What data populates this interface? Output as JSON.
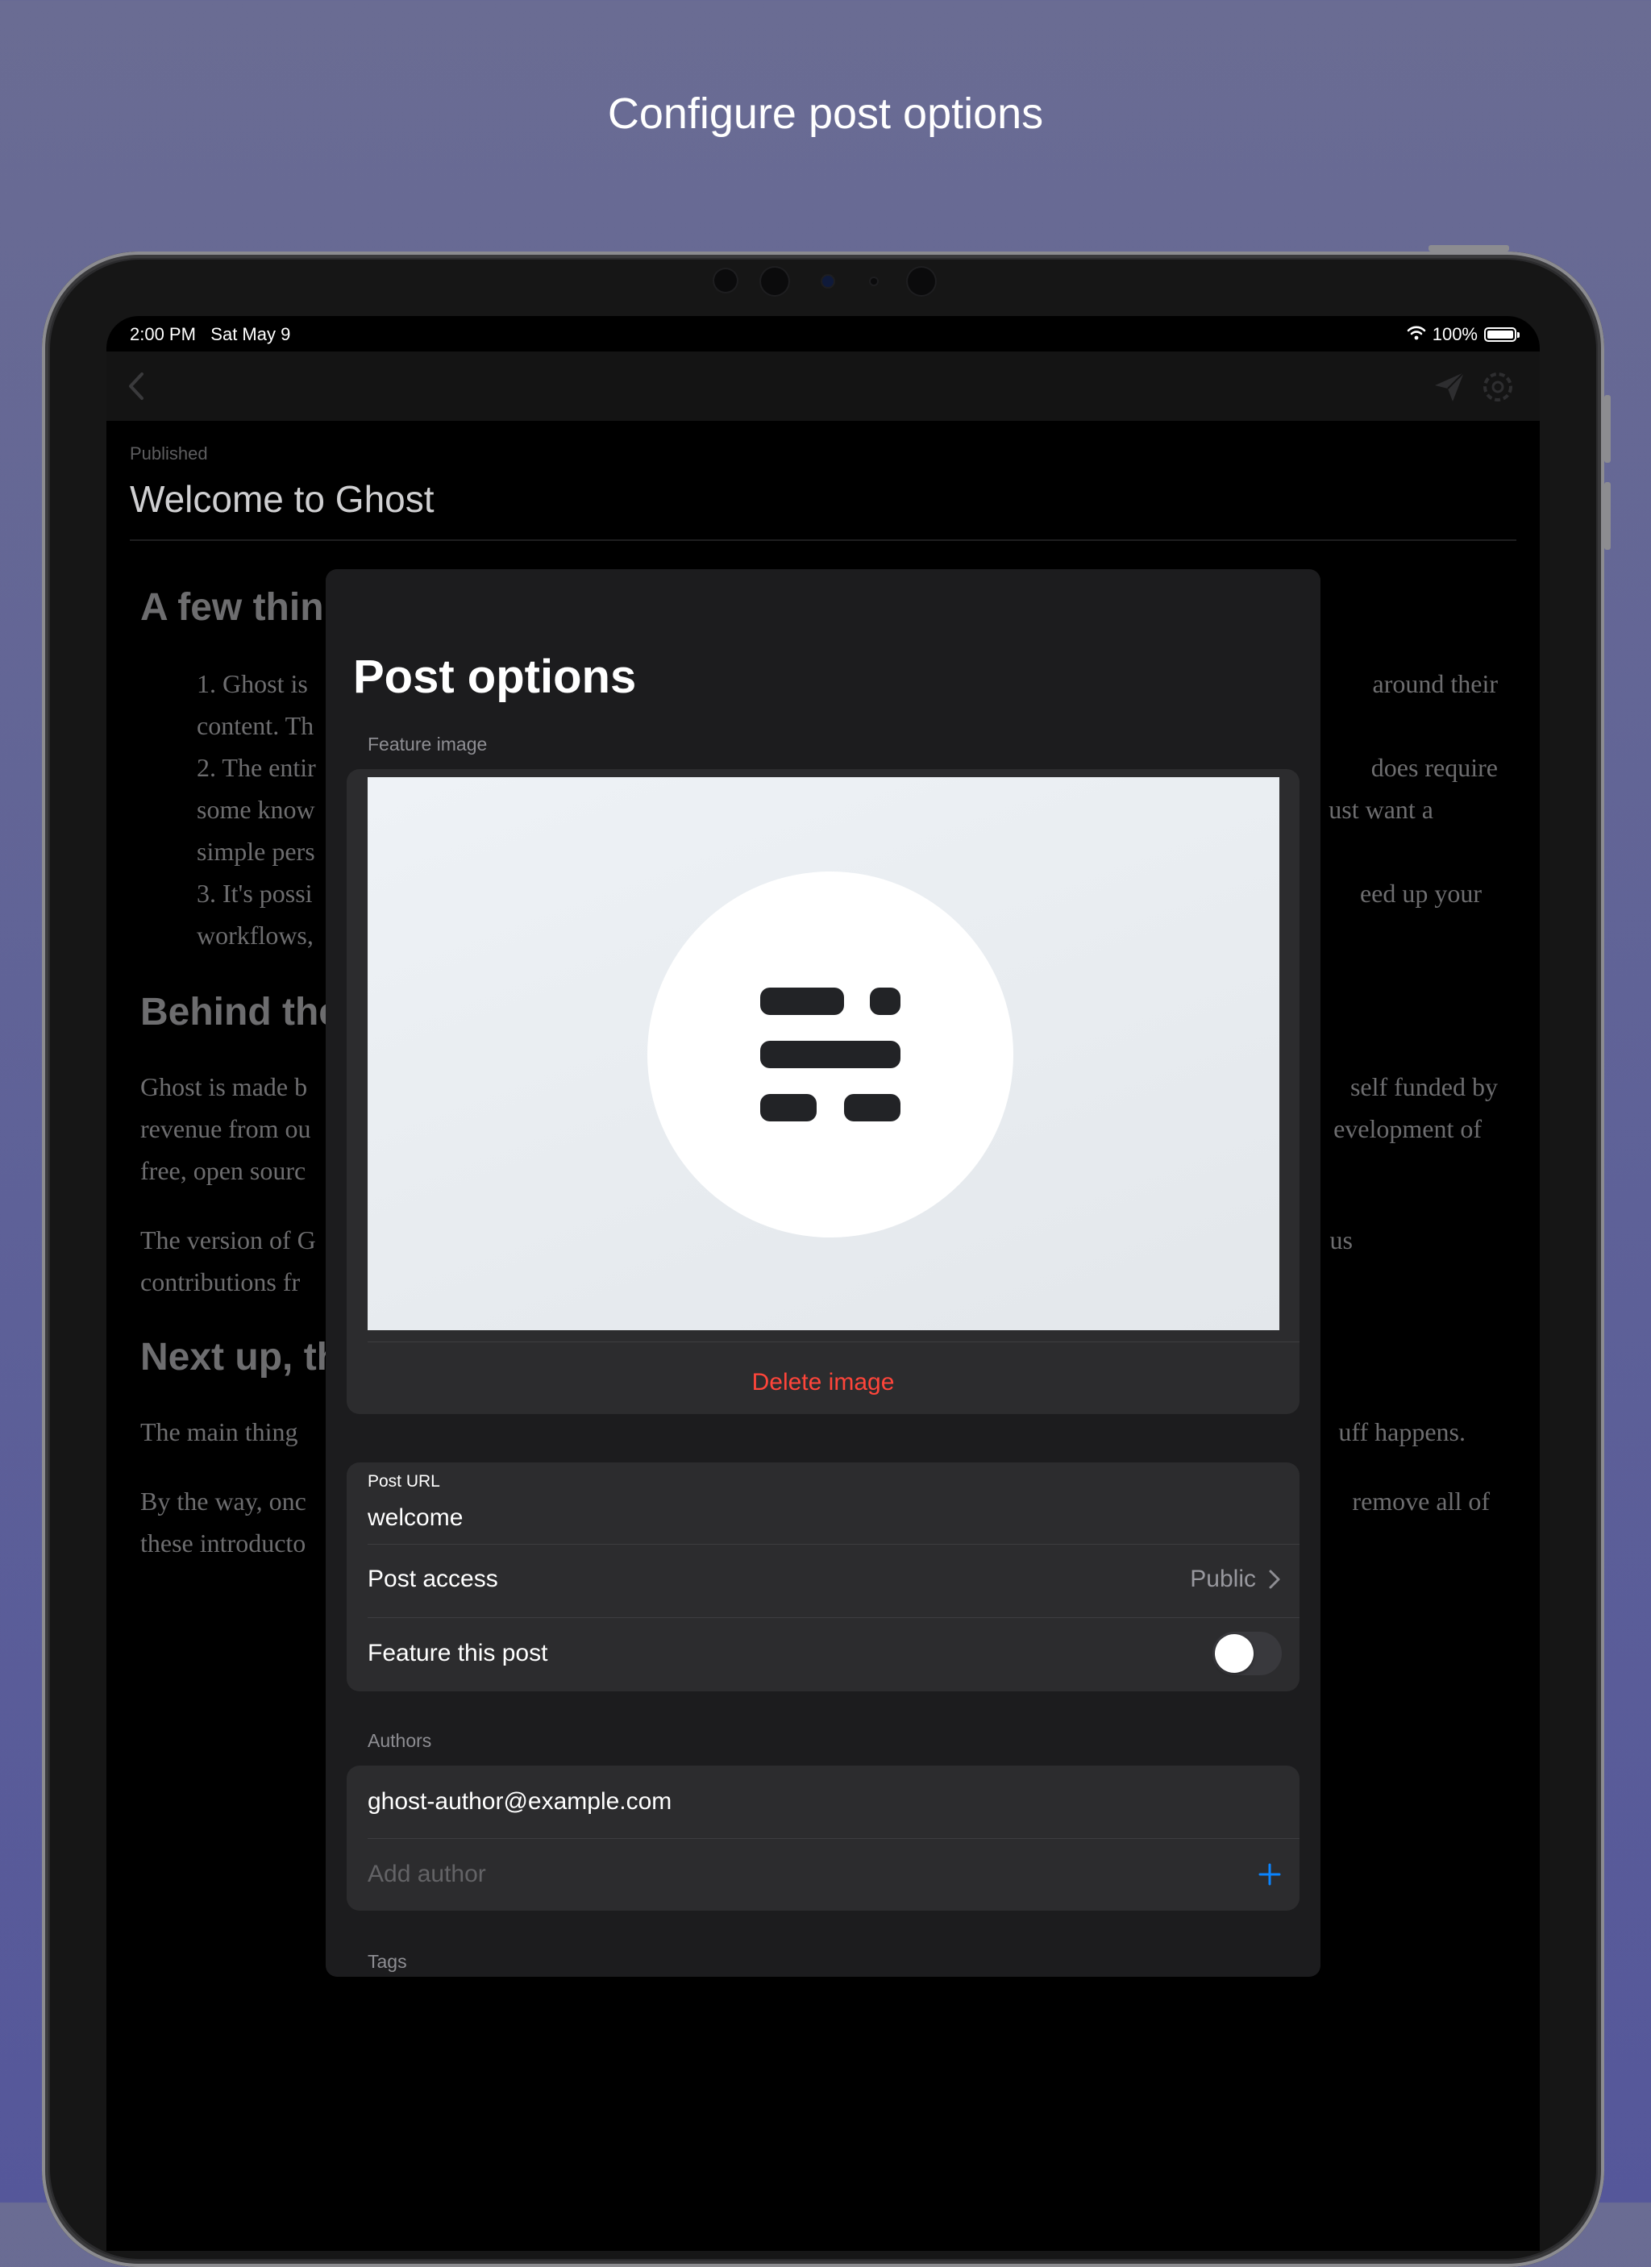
{
  "headline": "Configure post options",
  "status_bar": {
    "time": "2:00 PM",
    "date": "Sat May 9",
    "battery": "100%",
    "icons": [
      "wifi-icon",
      "battery-icon"
    ]
  },
  "nav": {
    "icons": [
      "chevron-left-icon",
      "send-icon",
      "gear-icon"
    ]
  },
  "editor": {
    "status": "Published",
    "title": "Welcome to Ghost",
    "visible_text": [
      {
        "kind": "heading",
        "left": "A few thin",
        "right": ""
      },
      {
        "kind": "text",
        "left": "1. Ghost is",
        "right": "around their"
      },
      {
        "kind": "text",
        "left": "content. Th",
        "right": ""
      },
      {
        "kind": "text",
        "left": "2. The entir",
        "right": "does require"
      },
      {
        "kind": "text",
        "left": "some know",
        "right": "ust want a"
      },
      {
        "kind": "text",
        "left": "simple pers",
        "right": ""
      },
      {
        "kind": "text",
        "left": "3. It's possi",
        "right": "eed up your"
      },
      {
        "kind": "text",
        "left": "workflows,",
        "right": ""
      },
      {
        "kind": "heading",
        "left": "Behind the",
        "right": ""
      },
      {
        "kind": "text",
        "left": "Ghost is made b",
        "right": "self funded by"
      },
      {
        "kind": "text",
        "left": "revenue from ou",
        "right": "evelopment of"
      },
      {
        "kind": "text",
        "left": "free, open sourc",
        "right": ""
      },
      {
        "kind": "text",
        "left": "The version of G",
        "right": "us"
      },
      {
        "kind": "text",
        "left": "contributions fr",
        "right": ""
      },
      {
        "kind": "heading",
        "left": "Next up, th",
        "right": ""
      },
      {
        "kind": "text",
        "left": "The main thing",
        "right": "uff happens."
      },
      {
        "kind": "text",
        "left": "By the way, onc",
        "right": "remove all of"
      },
      {
        "kind": "text",
        "left": "these introducto",
        "right": ""
      }
    ]
  },
  "modal": {
    "title": "Post options",
    "feature_image_label": "Feature image",
    "delete_image_label": "Delete image",
    "post_url_label": "Post URL",
    "post_url_value": "welcome",
    "post_access_label": "Post access",
    "post_access_value": "Public",
    "feature_post_label": "Feature this post",
    "feature_post_enabled": false,
    "authors_label": "Authors",
    "authors": [
      "ghost-author@example.com"
    ],
    "add_author_placeholder": "Add author",
    "tags_label": "Tags"
  },
  "colors": {
    "background": "#6a6c93",
    "destructive": "#ff453a",
    "accent": "#0a84ff",
    "card": "#2c2c2e",
    "sheet": "#1c1c1e"
  }
}
